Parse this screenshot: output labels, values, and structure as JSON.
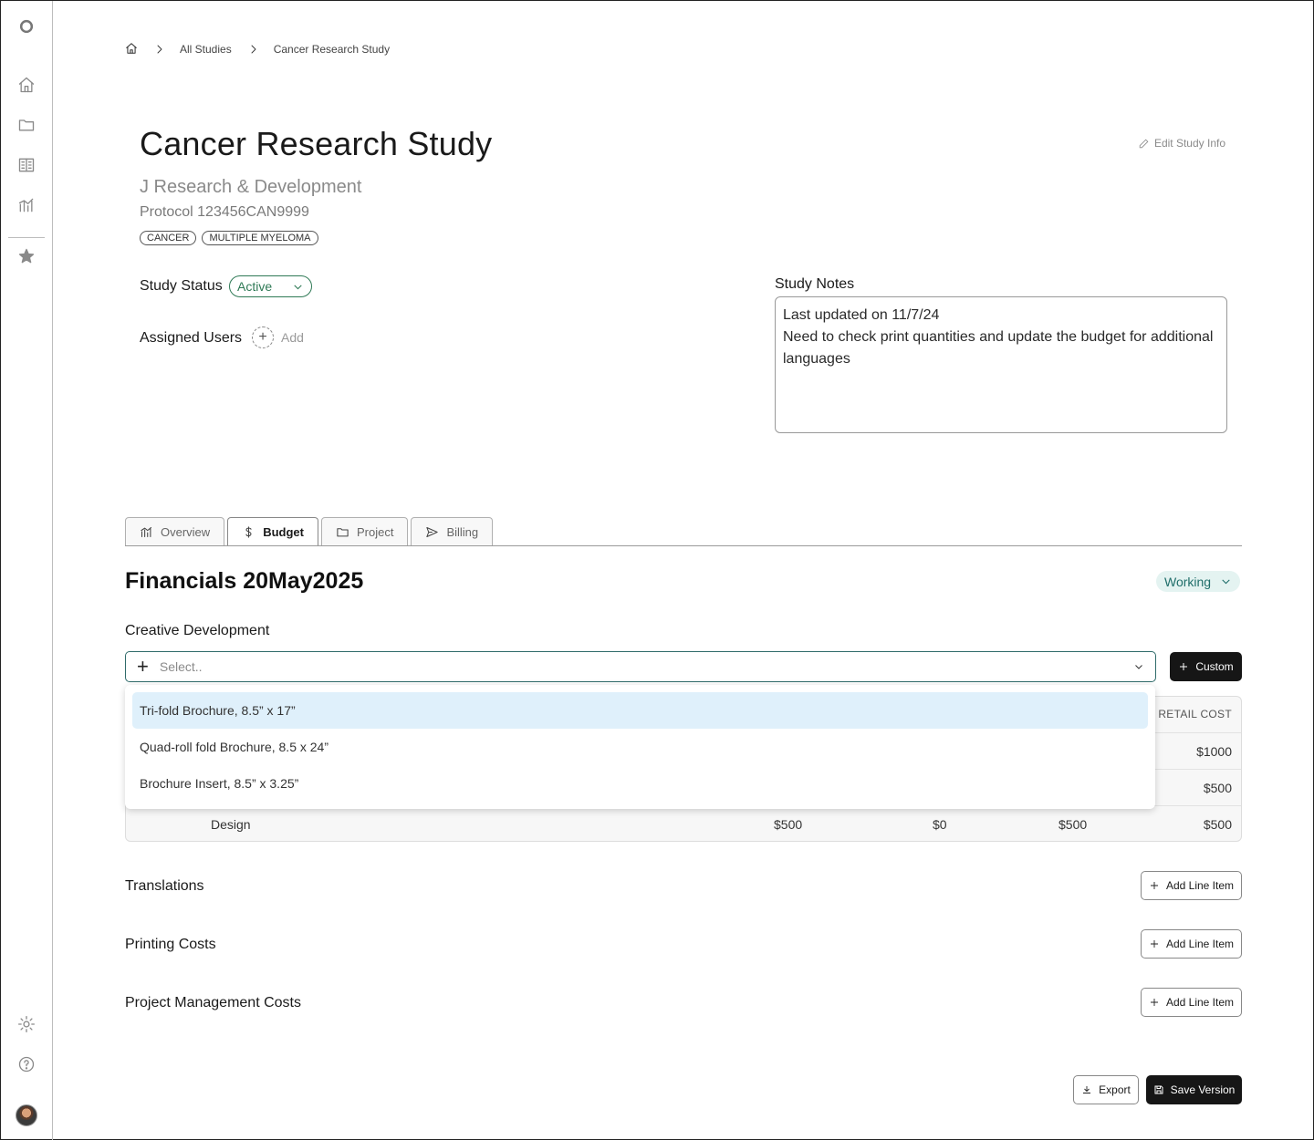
{
  "breadcrumb": {
    "items": [
      "All Studies",
      "Cancer Research Study"
    ]
  },
  "study": {
    "title": "Cancer Research Study",
    "org": "J Research & Development",
    "protocol": "Protocol 123456CAN9999",
    "tags": [
      "CANCER",
      "MULTIPLE MYELOMA"
    ],
    "edit_label": "Edit Study Info",
    "status_label": "Study Status",
    "status_value": "Active",
    "users_label": "Assigned Users",
    "add_user_label": "Add",
    "notes_label": "Study Notes",
    "notes_line1": "Last updated on 11/7/24",
    "notes_line2": "Need to check print quantities and update the budget for additional languages"
  },
  "tabs": [
    {
      "label": "Overview",
      "icon": "chart-icon"
    },
    {
      "label": "Budget",
      "icon": "dollar-icon"
    },
    {
      "label": "Project",
      "icon": "folder-icon"
    },
    {
      "label": "Billing",
      "icon": "send-icon"
    }
  ],
  "financials": {
    "title": "Financials 20May2025",
    "version_state": "Working"
  },
  "creative": {
    "label": "Creative Development",
    "select_placeholder": "Select..",
    "custom_label": "Custom",
    "options": [
      "Tri-fold Brochure, 8.5” x 17”",
      "Quad-roll fold Brochure, 8.5 x 24”",
      "Brochure Insert, 8.5” x 3.25”"
    ],
    "table_header_retail": "RETAIL COST",
    "rows": [
      {
        "name": "",
        "c1": "",
        "c2": "",
        "c3": "",
        "retail": "$1000"
      },
      {
        "name": "",
        "c1": "",
        "c2": "",
        "c3": "",
        "retail": "$500"
      },
      {
        "name": "Design",
        "c1": "$500",
        "c2": "$0",
        "c3": "$500",
        "retail": "$500"
      }
    ]
  },
  "sections": {
    "translations": "Translations",
    "printing": "Printing Costs",
    "pm": "Project Management Costs",
    "add_line_item": "Add Line Item"
  },
  "footer": {
    "export_label": "Export",
    "save_label": "Save Version"
  },
  "colors": {
    "accent_green": "#2f7a56",
    "teal": "#1f6e6a",
    "dark": "#161616"
  }
}
